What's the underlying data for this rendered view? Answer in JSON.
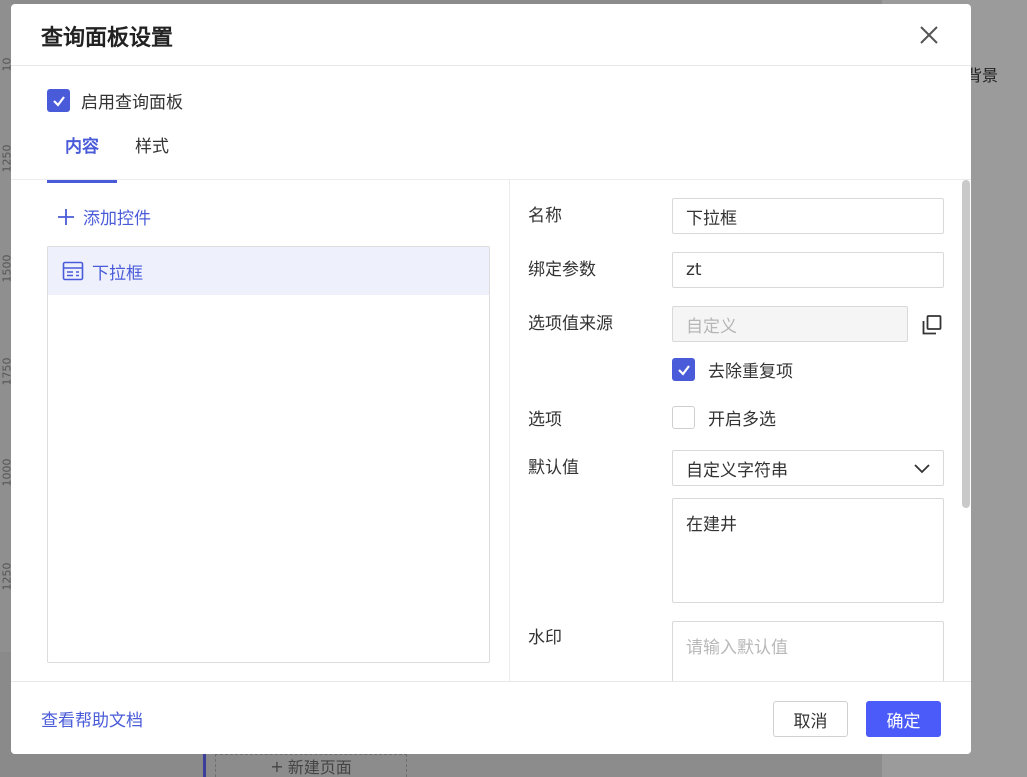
{
  "background": {
    "ruler_ticks": [
      "10",
      "1250",
      "1500",
      "1750",
      "1000",
      "1250"
    ],
    "right_panel_text": "背景",
    "new_page_label": "新建页面"
  },
  "modal": {
    "title": "查询面板设置",
    "enable_label": "启用查询面板",
    "enable_checked": true,
    "tabs": [
      {
        "label": "内容",
        "active": true
      },
      {
        "label": "样式",
        "active": false
      }
    ],
    "add_control_label": "添加控件",
    "controls": [
      {
        "label": "下拉框",
        "icon": "dropdown-control-icon",
        "selected": true
      }
    ],
    "form": {
      "name_label": "名称",
      "name_value": "下拉框",
      "param_label": "绑定参数",
      "param_value": "zt",
      "source_label": "选项值来源",
      "source_value": "自定义",
      "dedupe_label": "去除重复项",
      "dedupe_checked": true,
      "options_label": "选项",
      "multi_label": "开启多选",
      "multi_checked": false,
      "default_label": "默认值",
      "default_type": "自定义字符串",
      "default_value": "在建井",
      "watermark_label": "水印",
      "watermark_placeholder": "请输入默认值"
    },
    "footer": {
      "help_link": "查看帮助文档",
      "cancel_label": "取消",
      "ok_label": "确定"
    }
  },
  "colors": {
    "accent": "#4a5bd9",
    "primary_button": "#4a5bfa"
  }
}
